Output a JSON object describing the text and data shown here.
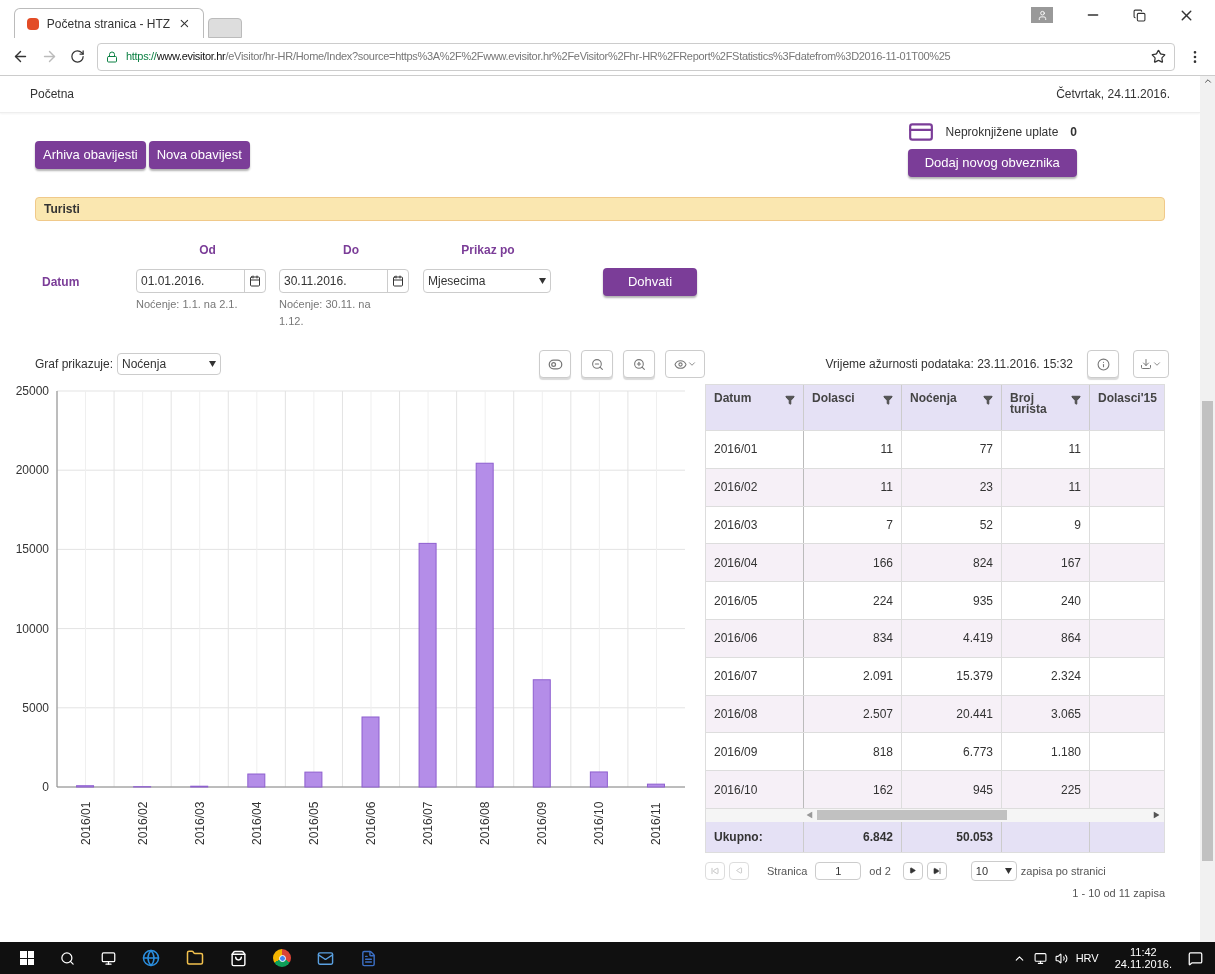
{
  "browser": {
    "tab_title": "Početna stranica - HTZ",
    "url_scheme": "https://",
    "url_host": "www.evisitor.hr",
    "url_path": "/eVisitor/hr-HR/Home/Index?source=https%3A%2F%2Fwww.evisitor.hr%2FeVisitor%2Fhr-HR%2FReport%2FStatistics%3Fdatefrom%3D2016-11-01T00%25"
  },
  "header": {
    "breadcrumb": "Početna",
    "date": "Četvrtak, 24.11.2016."
  },
  "payments": {
    "label": "Neproknjižene uplate",
    "count": "0"
  },
  "buttons": [
    "Arhiva obavijesti",
    "Nova obavijest"
  ],
  "add_button": "Dodaj novog obveznika",
  "section": {
    "title": "Turisti"
  },
  "filter": {
    "row_label": "Datum",
    "from_label": "Od",
    "from_value": "01.01.2016.",
    "from_hint": "Noćenje: 1.1. na 2.1.",
    "to_label": "Do",
    "to_value": "30.11.2016.",
    "to_hint": "Noćenje: 30.11. na 1.12.",
    "group_label": "Prikaz po",
    "group_value": "Mjesecima",
    "fetch_button": "Dohvati"
  },
  "graph": {
    "label": "Graf prikazuje:",
    "select": "Noćenja",
    "chart_data": {
      "type": "bar",
      "categories": [
        "2016/01",
        "2016/02",
        "2016/03",
        "2016/04",
        "2016/05",
        "2016/06",
        "2016/07",
        "2016/08",
        "2016/09",
        "2016/10",
        "2016/11"
      ],
      "series": [
        {
          "color": "#b48de8",
          "values": [
            80,
            20,
            50,
            820,
            940,
            4420,
            15380,
            20440,
            6770,
            950,
            180
          ]
        }
      ],
      "ylim": [
        0,
        25000
      ],
      "grid": true,
      "yticks": [
        0,
        5000,
        10000,
        15000,
        20000,
        25000
      ]
    }
  },
  "table": {
    "updated": "Vrijeme ažurnosti podataka: 23.11.2016. 15:32",
    "columns": [
      "Datum",
      "Dolasci",
      "Noćenja",
      "Broj turista",
      "Dolasci'15"
    ],
    "rows": [
      [
        "2016/01",
        "11",
        "77",
        "11"
      ],
      [
        "2016/02",
        "11",
        "23",
        "11"
      ],
      [
        "2016/03",
        "7",
        "52",
        "9"
      ],
      [
        "2016/04",
        "166",
        "824",
        "167"
      ],
      [
        "2016/05",
        "224",
        "935",
        "240"
      ],
      [
        "2016/06",
        "834",
        "4.419",
        "864"
      ],
      [
        "2016/07",
        "2.091",
        "15.379",
        "2.324"
      ],
      [
        "2016/08",
        "2.507",
        "20.441",
        "3.065"
      ],
      [
        "2016/09",
        "818",
        "6.773",
        "1.180"
      ],
      [
        "2016/10",
        "162",
        "945",
        "225"
      ]
    ],
    "totals": [
      "Ukupno:",
      "6.842",
      "50.053"
    ],
    "pagination": {
      "page_label": "Stranica",
      "page": "1",
      "of": "od 2",
      "per_page": "10",
      "per_page_label": "zapisa po stranici",
      "summary": "1 - 10 od 11 zapisa"
    }
  },
  "taskbar": {
    "language": "HRV",
    "time": "11:42",
    "date": "24.11.2016."
  }
}
